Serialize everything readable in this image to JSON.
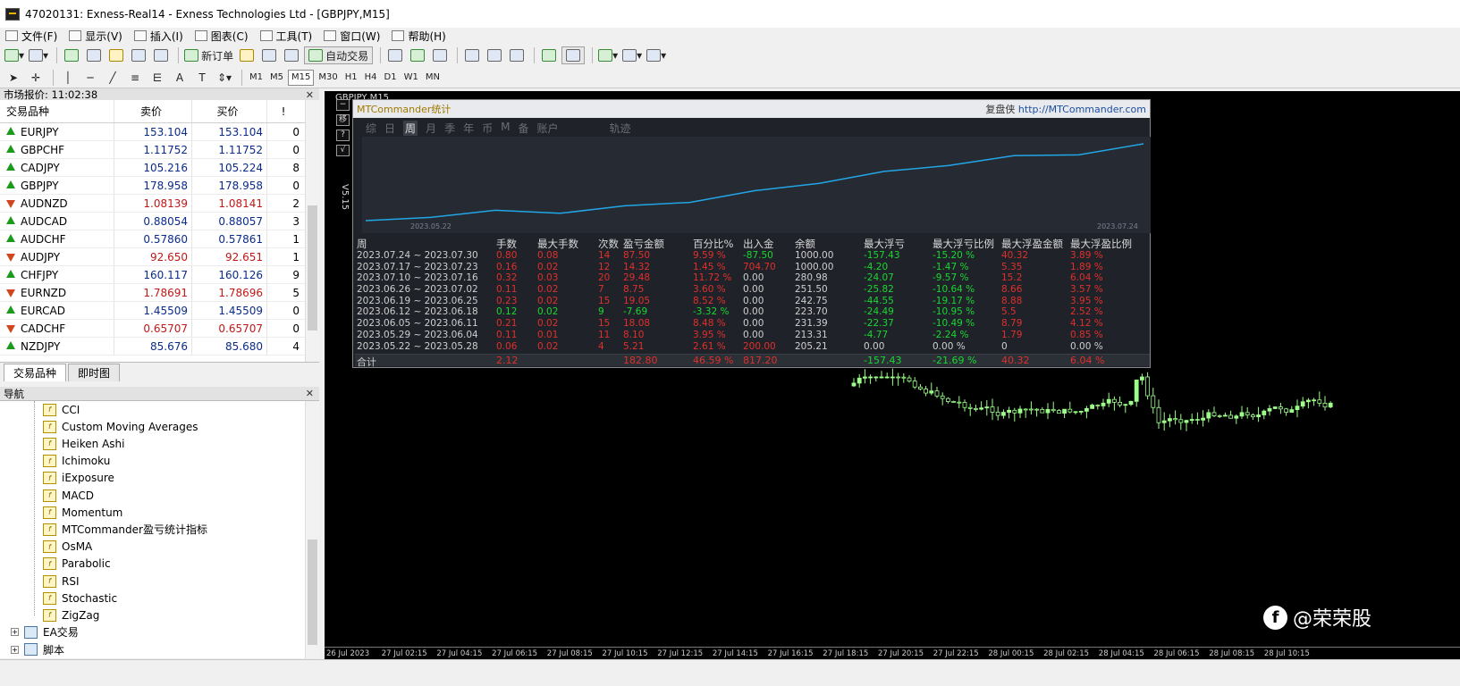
{
  "window": {
    "title": "47020131: Exness-Real14 - Exness Technologies Ltd - [GBPJPY,M15]"
  },
  "menu": [
    {
      "label": "文件(F)"
    },
    {
      "label": "显示(V)"
    },
    {
      "label": "插入(I)"
    },
    {
      "label": "图表(C)"
    },
    {
      "label": "工具(T)"
    },
    {
      "label": "窗口(W)"
    },
    {
      "label": "帮助(H)"
    }
  ],
  "toolbar": {
    "new_order": "新订单",
    "auto_trading": "自动交易"
  },
  "timeframes": [
    "M1",
    "M5",
    "M15",
    "M30",
    "H1",
    "H4",
    "D1",
    "W1",
    "MN"
  ],
  "active_timeframe": "M15",
  "market_watch": {
    "header": "市场报价: 11:02:38",
    "columns": {
      "symbol": "交易品种",
      "bid": "卖价",
      "ask": "买价",
      "spread": "!"
    },
    "rows": [
      {
        "symbol": "EURJPY",
        "bid": "153.104",
        "ask": "153.104",
        "spread": "0",
        "dir": "up"
      },
      {
        "symbol": "GBPCHF",
        "bid": "1.11752",
        "ask": "1.11752",
        "spread": "0",
        "dir": "up"
      },
      {
        "symbol": "CADJPY",
        "bid": "105.216",
        "ask": "105.224",
        "spread": "8",
        "dir": "up"
      },
      {
        "symbol": "GBPJPY",
        "bid": "178.958",
        "ask": "178.958",
        "spread": "0",
        "dir": "up"
      },
      {
        "symbol": "AUDNZD",
        "bid": "1.08139",
        "ask": "1.08141",
        "spread": "2",
        "dir": "down"
      },
      {
        "symbol": "AUDCAD",
        "bid": "0.88054",
        "ask": "0.88057",
        "spread": "3",
        "dir": "up"
      },
      {
        "symbol": "AUDCHF",
        "bid": "0.57860",
        "ask": "0.57861",
        "spread": "1",
        "dir": "up"
      },
      {
        "symbol": "AUDJPY",
        "bid": "92.650",
        "ask": "92.651",
        "spread": "1",
        "dir": "down"
      },
      {
        "symbol": "CHFJPY",
        "bid": "160.117",
        "ask": "160.126",
        "spread": "9",
        "dir": "up"
      },
      {
        "symbol": "EURNZD",
        "bid": "1.78691",
        "ask": "1.78696",
        "spread": "5",
        "dir": "down"
      },
      {
        "symbol": "EURCAD",
        "bid": "1.45509",
        "ask": "1.45509",
        "spread": "0",
        "dir": "up"
      },
      {
        "symbol": "CADCHF",
        "bid": "0.65707",
        "ask": "0.65707",
        "spread": "0",
        "dir": "down"
      },
      {
        "symbol": "NZDJPY",
        "bid": "85.676",
        "ask": "85.680",
        "spread": "4",
        "dir": "up"
      }
    ],
    "tabs": [
      "交易品种",
      "即时图"
    ]
  },
  "navigator": {
    "header": "导航",
    "indicators": [
      "CCI",
      "Custom Moving Averages",
      "Heiken Ashi",
      "Ichimoku",
      "iExposure",
      "MACD",
      "Momentum",
      "MTCommander盈亏统计指标",
      "OsMA",
      "Parabolic",
      "RSI",
      "Stochastic",
      "ZigZag"
    ],
    "groups": [
      {
        "label": "EA交易"
      },
      {
        "label": "脚本"
      }
    ]
  },
  "chart": {
    "title": "GBPJPY,M15",
    "version": "V5.15",
    "left_buttons": [
      "−",
      "移",
      "?",
      "√"
    ],
    "time_axis": [
      "26 Jul 2023",
      "27 Jul 02:15",
      "27 Jul 04:15",
      "27 Jul 06:15",
      "27 Jul 08:15",
      "27 Jul 10:15",
      "27 Jul 12:15",
      "27 Jul 14:15",
      "27 Jul 16:15",
      "27 Jul 18:15",
      "27 Jul 20:15",
      "27 Jul 22:15",
      "28 Jul 00:15",
      "28 Jul 02:15",
      "28 Jul 04:15",
      "28 Jul 06:15",
      "28 Jul 08:15",
      "28 Jul 10:15"
    ]
  },
  "stats": {
    "title": "MTCommander统计",
    "site_name": "复盘侠",
    "site_url": "http://MTCommander.com",
    "period_tabs": [
      "综",
      "日",
      "周",
      "月",
      "季",
      "年",
      "币",
      "M",
      "备",
      "账户",
      "轨迹"
    ],
    "active_tab": "周",
    "equity_start_label": "2023.05.22",
    "equity_end_label": "2023.07.24",
    "columns": [
      "周",
      "手数",
      "最大手数",
      "次数",
      "盈亏金额",
      "百分比%",
      "出入金",
      "余额",
      "最大浮亏",
      "最大浮亏比例",
      "最大浮盈金额",
      "最大浮盈比例"
    ],
    "rows": [
      [
        "2023.07.24 ~ 2023.07.30",
        "0.80",
        "0.08",
        "14",
        "87.50",
        "9.59 %",
        "-87.50",
        "1000.00",
        "-157.43",
        "-15.20 %",
        "40.32",
        "3.89 %"
      ],
      [
        "2023.07.17 ~ 2023.07.23",
        "0.16",
        "0.02",
        "12",
        "14.32",
        "1.45 %",
        "704.70",
        "1000.00",
        "-4.20",
        "-1.47 %",
        "5.35",
        "1.89 %"
      ],
      [
        "2023.07.10 ~ 2023.07.16",
        "0.32",
        "0.03",
        "20",
        "29.48",
        "11.72 %",
        "0.00",
        "280.98",
        "-24.07",
        "-9.57 %",
        "15.2",
        "6.04 %"
      ],
      [
        "2023.06.26 ~ 2023.07.02",
        "0.11",
        "0.02",
        "7",
        "8.75",
        "3.60 %",
        "0.00",
        "251.50",
        "-25.82",
        "-10.64 %",
        "8.66",
        "3.57 %"
      ],
      [
        "2023.06.19 ~ 2023.06.25",
        "0.23",
        "0.02",
        "15",
        "19.05",
        "8.52 %",
        "0.00",
        "242.75",
        "-44.55",
        "-19.17 %",
        "8.88",
        "3.95 %"
      ],
      [
        "2023.06.12 ~ 2023.06.18",
        "0.12",
        "0.02",
        "9",
        "-7.69",
        "-3.32 %",
        "0.00",
        "223.70",
        "-24.49",
        "-10.95 %",
        "5.5",
        "2.52 %"
      ],
      [
        "2023.06.05 ~ 2023.06.11",
        "0.21",
        "0.02",
        "15",
        "18.08",
        "8.48 %",
        "0.00",
        "231.39",
        "-22.37",
        "-10.49 %",
        "8.79",
        "4.12 %"
      ],
      [
        "2023.05.29 ~ 2023.06.04",
        "0.11",
        "0.01",
        "11",
        "8.10",
        "3.95 %",
        "0.00",
        "213.31",
        "-4.77",
        "-2.24 %",
        "1.79",
        "0.85 %"
      ],
      [
        "2023.05.22 ~ 2023.05.28",
        "0.06",
        "0.02",
        "4",
        "5.21",
        "2.61 %",
        "200.00",
        "205.21",
        "0.00",
        "0.00 %",
        "0",
        "0.00 %"
      ]
    ],
    "row_colors": [
      "r",
      "r",
      "r",
      "r",
      "r",
      "g",
      "r",
      "r",
      "r"
    ],
    "total": {
      "label": "合计",
      "lots": "2.12",
      "pnl": "182.80",
      "pct": "46.59 %",
      "flow": "817.20",
      "max_dd": "-157.43",
      "max_dd_pct": "-21.69 %",
      "max_fp": "40.32",
      "max_fp_pct": "6.04 %"
    }
  },
  "watermark": {
    "text": "@荣荣股"
  },
  "colors": {
    "chart_bg": "#000000",
    "candle": "#9dff8a",
    "equity_line": "#22a6e6",
    "loss": "#e0302b",
    "gain": "#19d830"
  }
}
